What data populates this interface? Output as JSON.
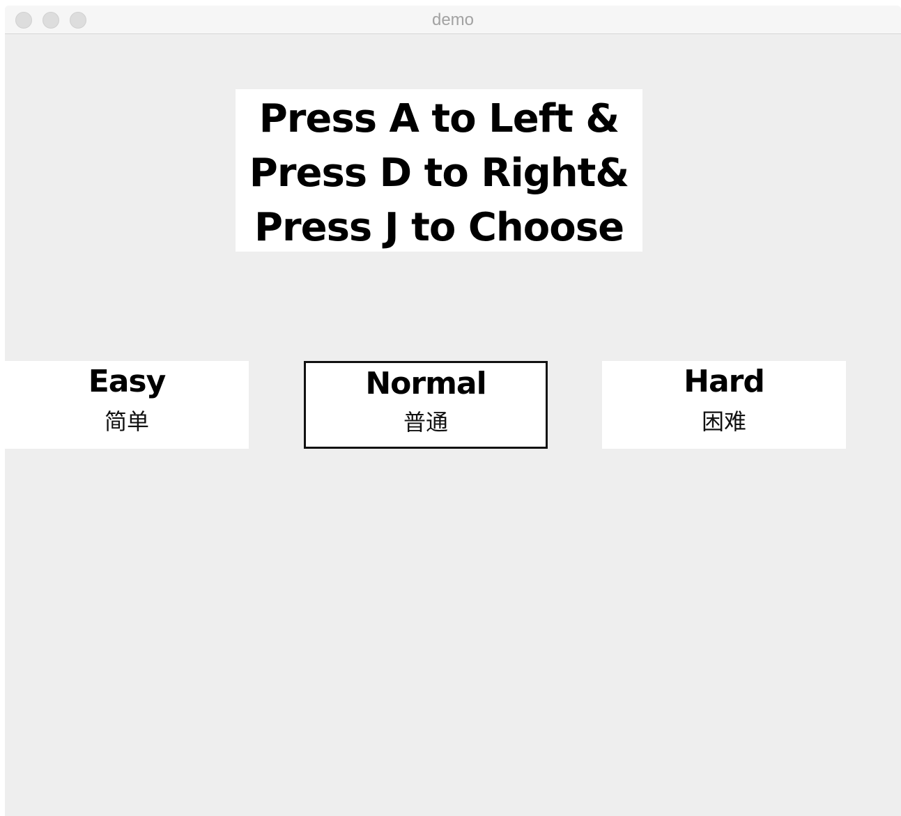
{
  "window": {
    "title": "demo"
  },
  "instructions": {
    "lines": [
      "Press A to Left &",
      "Press D to Right&",
      "Press J to Choose"
    ]
  },
  "difficulty": {
    "selected": "Normal",
    "options": [
      {
        "title": "Easy",
        "subtitle": "简单"
      },
      {
        "title": "Normal",
        "subtitle": "普通"
      },
      {
        "title": "Hard",
        "subtitle": "困难"
      }
    ]
  },
  "colors": {
    "background": "#eeeeee",
    "panel": "#ffffff",
    "selected_border": "#111111",
    "text": "#000000"
  }
}
